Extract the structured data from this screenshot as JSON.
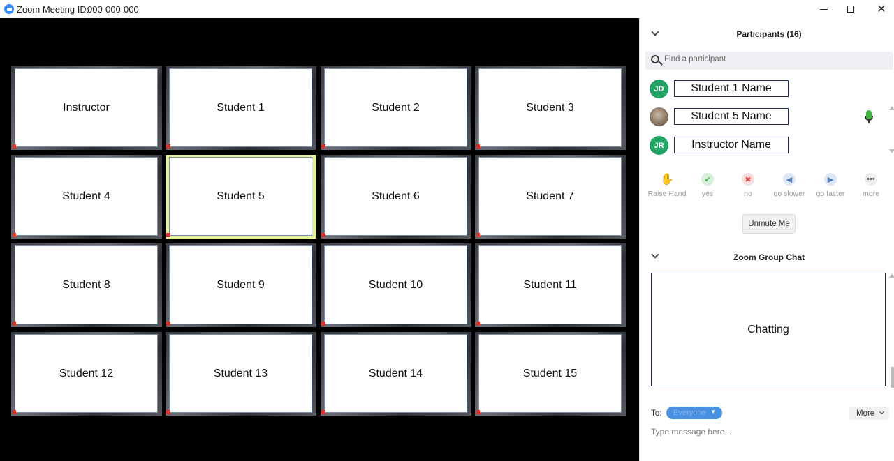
{
  "window": {
    "title_label": "Zoom Meeting ID:",
    "meeting_id": "000-000-000",
    "minimize_icon": "minimize-icon",
    "maximize_icon": "maximize-icon",
    "close_glyph": "✕"
  },
  "gallery": {
    "tiles": [
      {
        "name": "Instructor",
        "active": false
      },
      {
        "name": "Student 1",
        "active": false
      },
      {
        "name": "Student 2",
        "active": false
      },
      {
        "name": "Student 3",
        "active": false
      },
      {
        "name": "Student 4",
        "active": false
      },
      {
        "name": "Student 5",
        "active": true
      },
      {
        "name": "Student 6",
        "active": false
      },
      {
        "name": "Student 7",
        "active": false
      },
      {
        "name": "Student 8",
        "active": false
      },
      {
        "name": "Student 9",
        "active": false
      },
      {
        "name": "Student 10",
        "active": false
      },
      {
        "name": "Student 11",
        "active": false
      },
      {
        "name": "Student 12",
        "active": false
      },
      {
        "name": "Student 13",
        "active": false
      },
      {
        "name": "Student 14",
        "active": false
      },
      {
        "name": "Student 15",
        "active": false
      }
    ],
    "active_color": "#e4f29a"
  },
  "participants": {
    "title": "Participants (16)",
    "search_placeholder": "Find a participant",
    "list": [
      {
        "initials": "JD",
        "name": "Student 1 Name",
        "avatar": "initials",
        "mic_on": false
      },
      {
        "initials": "",
        "name": "Student 5 Name",
        "avatar": "photo",
        "mic_on": true
      },
      {
        "initials": "JR",
        "name": "Instructor Name",
        "avatar": "initials",
        "mic_on": false
      }
    ],
    "reactions": [
      {
        "label": "Raise Hand",
        "icon": "raise-hand-icon",
        "glyph": "✋"
      },
      {
        "label": "yes",
        "icon": "check-icon",
        "glyph": "✔"
      },
      {
        "label": "no",
        "icon": "x-icon",
        "glyph": "✖"
      },
      {
        "label": "go slower",
        "icon": "rewind-icon",
        "glyph": "◀"
      },
      {
        "label": "go faster",
        "icon": "fast-forward-icon",
        "glyph": "▶"
      },
      {
        "label": "more",
        "icon": "ellipsis-icon",
        "glyph": "•••"
      }
    ],
    "unmute_label": "Unmute Me"
  },
  "chat": {
    "title": "Zoom Group Chat",
    "body_text": "Chatting",
    "to_label": "To:",
    "recipient": "Everyone",
    "more_label": "More",
    "message_placeholder": "Type message here..."
  },
  "colors": {
    "accent": "#2d8cff",
    "avatar_green": "#21a465",
    "pill_blue": "#4a90e2"
  }
}
